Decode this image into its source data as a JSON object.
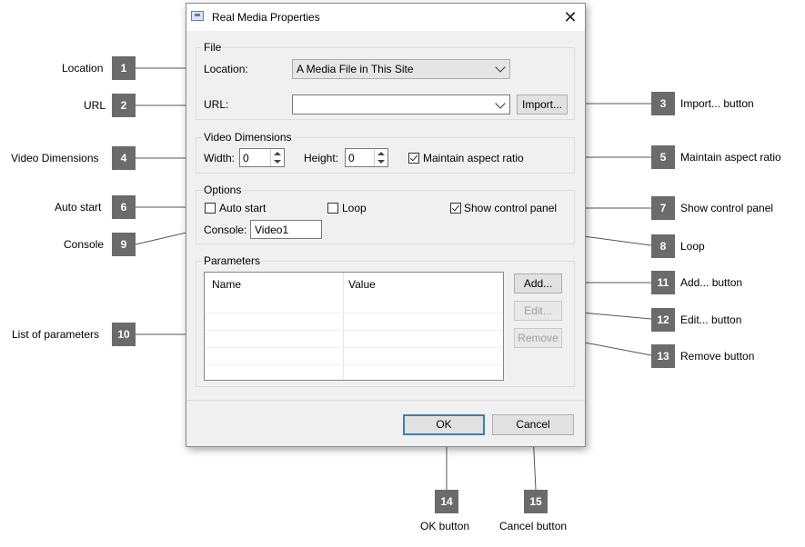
{
  "dialog": {
    "title": "Real Media Properties",
    "close_glyph": "✕",
    "file_group": {
      "label": "File",
      "location_label": "Location:",
      "location_value": "A Media File in This Site",
      "url_label": "URL:",
      "url_value": "",
      "import_button": "Import..."
    },
    "video_group": {
      "label": "Video Dimensions",
      "width_label": "Width:",
      "width_value": "0",
      "height_label": "Height:",
      "height_value": "0",
      "maintain_aspect_label": "Maintain aspect ratio",
      "maintain_aspect_checked": true
    },
    "options_group": {
      "label": "Options",
      "auto_start_label": "Auto start",
      "auto_start_checked": false,
      "loop_label": "Loop",
      "loop_checked": false,
      "show_control_panel_label": "Show control panel",
      "show_control_panel_checked": true,
      "console_label": "Console:",
      "console_value": "Video1"
    },
    "parameters_group": {
      "label": "Parameters",
      "columns": [
        "Name",
        "Value"
      ],
      "add_button": "Add...",
      "edit_button": "Edit...",
      "remove_button": "Remove"
    },
    "ok_button": "OK",
    "cancel_button": "Cancel"
  },
  "callouts": [
    {
      "number": "1",
      "text": "Location"
    },
    {
      "number": "2",
      "text": "URL"
    },
    {
      "number": "3",
      "text": "Import... button"
    },
    {
      "number": "4",
      "text": "Video Dimensions"
    },
    {
      "number": "5",
      "text": "Maintain aspect ratio"
    },
    {
      "number": "6",
      "text": "Auto start"
    },
    {
      "number": "7",
      "text": "Show control panel"
    },
    {
      "number": "8",
      "text": "Loop"
    },
    {
      "number": "9",
      "text": "Console"
    },
    {
      "number": "10",
      "text": "List of parameters"
    },
    {
      "number": "11",
      "text": "Add... button"
    },
    {
      "number": "12",
      "text": "Edit... button"
    },
    {
      "number": "13",
      "text": "Remove button"
    },
    {
      "number": "14",
      "text": "OK button"
    },
    {
      "number": "15",
      "text": "Cancel button"
    }
  ],
  "colors": {
    "badge": "#6b6b6b",
    "dialog_bg": "#f0f0f0",
    "default_button_border": "#3c7fb1"
  }
}
